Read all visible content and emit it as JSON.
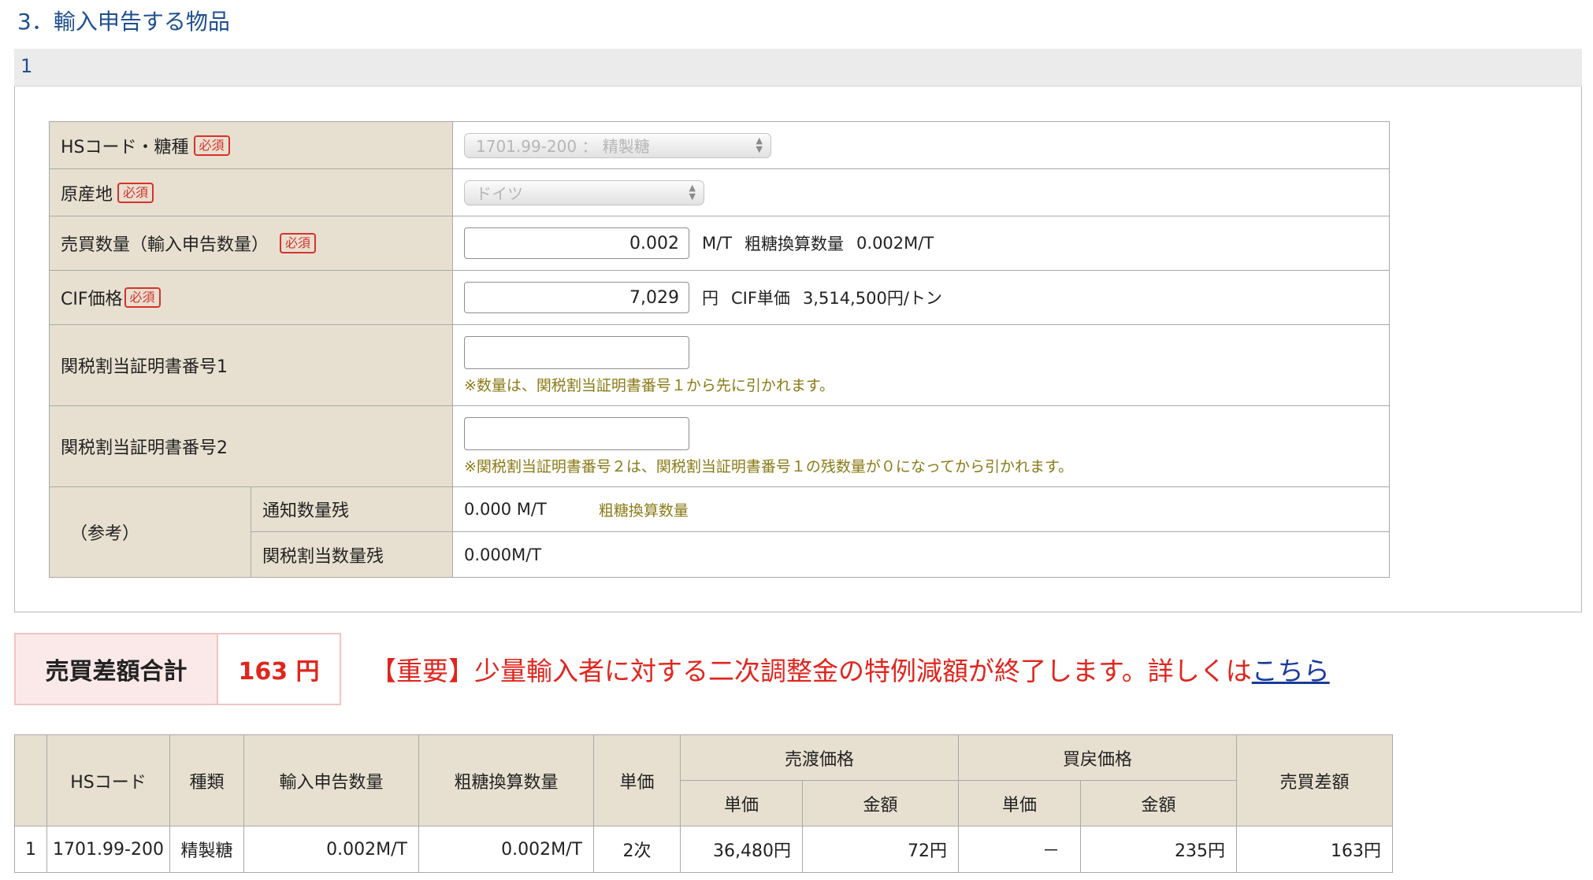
{
  "section": {
    "title": "3．輸入申告する物品",
    "item_number": "1"
  },
  "form": {
    "required_badge": "必須",
    "hs_code": {
      "label": "HSコード・糖種",
      "selected": "1701.99-200 ： 精製糖"
    },
    "origin": {
      "label": "原産地",
      "selected": "ドイツ"
    },
    "quantity": {
      "label": "売買数量（輸入申告数量）",
      "value": "0.002",
      "unit": "M/T",
      "converted_label": "粗糖換算数量",
      "converted_value": "0.002M/T"
    },
    "cif": {
      "label": "CIF価格",
      "value": "7,029",
      "unit": "円",
      "unit_price_label": "CIF単価",
      "unit_price_value": "3,514,500円/トン"
    },
    "cert1": {
      "label": "関税割当証明書番号1",
      "value": "",
      "note": "※数量は、関税割当証明書番号１から先に引かれます。"
    },
    "cert2": {
      "label": "関税割当証明書番号2",
      "value": "",
      "note": "※関税割当証明書番号２は、関税割当証明書番号１の残数量が０になってから引かれます。"
    },
    "reference": {
      "label": "（参考）",
      "notified_label": "通知数量残",
      "notified_value": "0.000 M/T",
      "notified_note": "粗糖換算数量",
      "quota_label": "関税割当数量残",
      "quota_value": "0.000M/T"
    }
  },
  "summary": {
    "label": "売買差額合計",
    "value": "163 円",
    "notice": "【重要】少量輸入者に対する二次調整金の特例減額が終了します。詳しくは",
    "link": "こちら"
  },
  "table": {
    "headers": {
      "hs_code": "HSコード",
      "type": "種類",
      "import_qty": "輸入申告数量",
      "raw_qty": "粗糖換算数量",
      "unit": "単価",
      "sell_group": "売渡価格",
      "sell_unit": "単価",
      "sell_amount": "金額",
      "buy_group": "買戻価格",
      "buy_unit": "単価",
      "buy_amount": "金額",
      "diff": "売買差額"
    },
    "rows": [
      {
        "no": "1",
        "hs_code": "1701.99-200",
        "type": "精製糖",
        "import_qty": "0.002M/T",
        "raw_qty": "0.002M/T",
        "unit": "2次",
        "sell_unit": "36,480円",
        "sell_amount": "72円",
        "buy_unit": "－",
        "buy_amount": "235円",
        "diff": "163円"
      }
    ]
  }
}
